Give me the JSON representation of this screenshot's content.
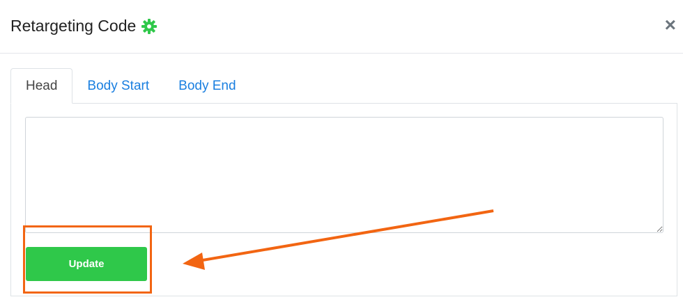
{
  "modal": {
    "title": "Retargeting Code",
    "close_label": "×"
  },
  "tabs": [
    {
      "label": "Head",
      "active": true
    },
    {
      "label": "Body Start",
      "active": false
    },
    {
      "label": "Body End",
      "active": false
    }
  ],
  "editor": {
    "value": ""
  },
  "actions": {
    "update_label": "Update"
  },
  "icons": {
    "title_icon": "gear-icon",
    "close_icon": "close-icon"
  },
  "colors": {
    "accent_green": "#2fc84a",
    "tab_link_blue": "#1a7fe0",
    "annotation_orange": "#f26512"
  }
}
